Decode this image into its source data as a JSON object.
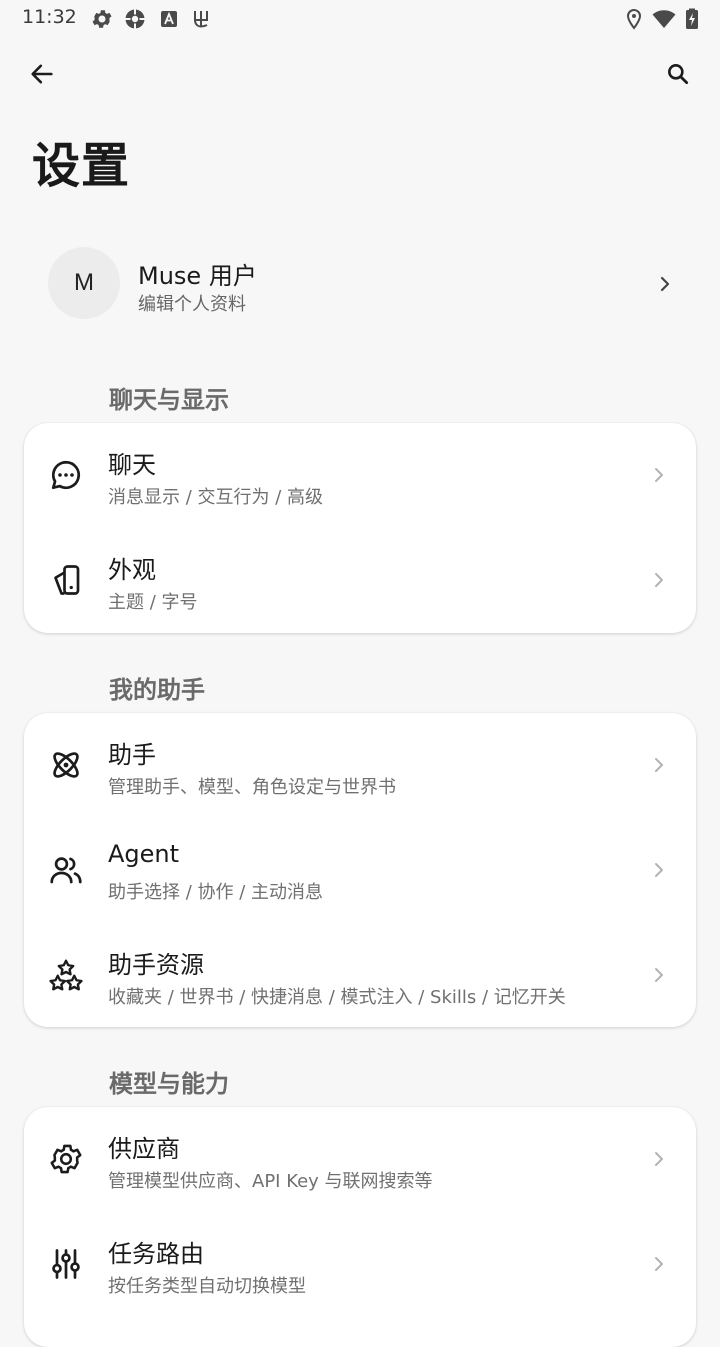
{
  "status_bar": {
    "time": "11:32"
  },
  "page": {
    "title": "设置"
  },
  "profile": {
    "avatar_letter": "M",
    "name": "Muse 用户",
    "subtitle": "编辑个人资料"
  },
  "sections": [
    {
      "header": "聊天与显示",
      "items": [
        {
          "icon": "chat-bubble-icon",
          "title": "聊天",
          "subtitle": "消息显示 / 交互行为 / 高级"
        },
        {
          "icon": "appearance-icon",
          "title": "外观",
          "subtitle": "主题 / 字号"
        }
      ]
    },
    {
      "header": "我的助手",
      "items": [
        {
          "icon": "atom-icon",
          "title": "助手",
          "subtitle": "管理助手、模型、角色设定与世界书"
        },
        {
          "icon": "people-icon",
          "title": "Agent",
          "subtitle": "助手选择 / 协作 / 主动消息"
        },
        {
          "icon": "shapes-icon",
          "title": "助手资源",
          "subtitle": "收藏夹 / 世界书 / 快捷消息 / 模式注入 / Skills / 记忆开关"
        }
      ]
    },
    {
      "header": "模型与能力",
      "items": [
        {
          "icon": "gear-icon",
          "title": "供应商",
          "subtitle": "管理模型供应商、API Key 与联网搜索等"
        },
        {
          "icon": "sliders-icon",
          "title": "任务路由",
          "subtitle": "按任务类型自动切换模型"
        }
      ]
    }
  ]
}
